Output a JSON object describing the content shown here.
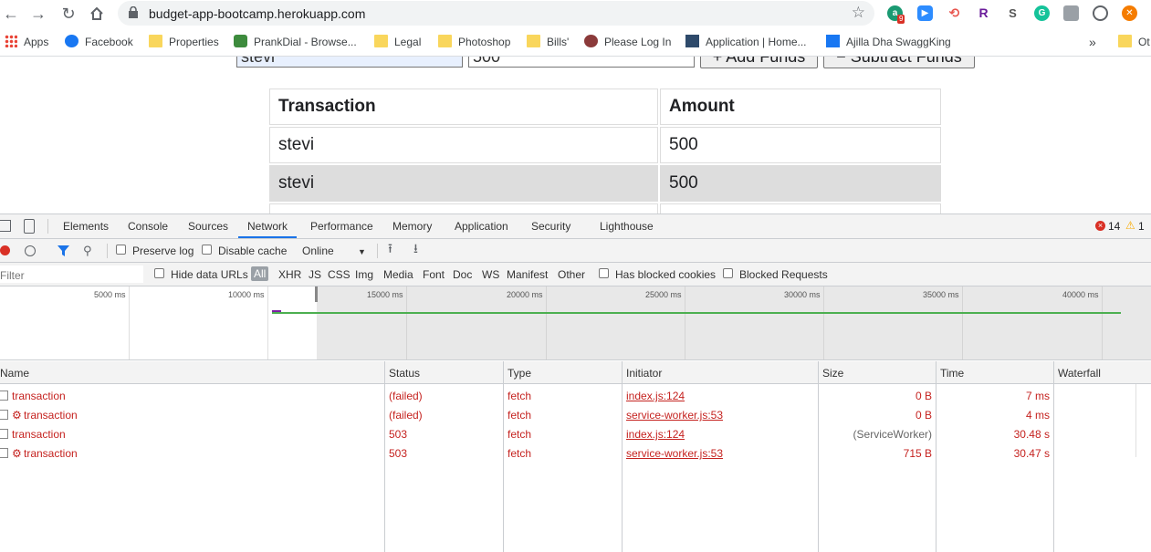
{
  "browser": {
    "url": "budget-app-bootcamp.herokuapp.com",
    "badge_count": "9"
  },
  "bookmarks": [
    {
      "label": "Apps",
      "icon": "apps-grid-icon"
    },
    {
      "label": "Facebook",
      "icon": "facebook-icon"
    },
    {
      "label": "Properties",
      "icon": "folder-icon"
    },
    {
      "label": "PrankDial - Browse...",
      "icon": "prankdial-icon"
    },
    {
      "label": "Legal",
      "icon": "folder-icon"
    },
    {
      "label": "Photoshop",
      "icon": "folder-icon"
    },
    {
      "label": "Bills'",
      "icon": "folder-icon"
    },
    {
      "label": "Please Log In",
      "icon": "globe-icon"
    },
    {
      "label": "Application | Home...",
      "icon": "app-icon"
    },
    {
      "label": "Ajilla Dha SwaggKing",
      "icon": "facebook-icon"
    }
  ],
  "bookmarks_overflow": "»",
  "bookmarks_other": "Ot",
  "page": {
    "name_value": "stevi",
    "amount_value": "500",
    "add_button": "+ Add Funds",
    "subtract_button": "− Subtract Funds",
    "table": {
      "headers": [
        "Transaction",
        "Amount"
      ],
      "rows": [
        [
          "stevi",
          "500"
        ],
        [
          "stevi",
          "500"
        ]
      ]
    }
  },
  "devtools": {
    "tabs": [
      "Elements",
      "Console",
      "Sources",
      "Network",
      "Performance",
      "Memory",
      "Application",
      "Security",
      "Lighthouse"
    ],
    "active_tab": "Network",
    "errors": "14",
    "warnings": "1",
    "preserve_log": "Preserve log",
    "disable_cache": "Disable cache",
    "throttle": "Online",
    "filter_placeholder": "Filter",
    "hide_data_urls": "Hide data URLs",
    "filter_types": [
      "All",
      "XHR",
      "JS",
      "CSS",
      "Img",
      "Media",
      "Font",
      "Doc",
      "WS",
      "Manifest",
      "Other"
    ],
    "has_blocked_cookies": "Has blocked cookies",
    "blocked_requests": "Blocked Requests",
    "timeline_ticks": [
      "5000 ms",
      "10000 ms",
      "15000 ms",
      "20000 ms",
      "25000 ms",
      "30000 ms",
      "35000 ms",
      "40000 ms"
    ],
    "columns": [
      "Name",
      "Status",
      "Type",
      "Initiator",
      "Size",
      "Time",
      "Waterfall"
    ],
    "requests": [
      {
        "name": "transaction",
        "worker": false,
        "status": "(failed)",
        "type": "fetch",
        "initiator": "index.js:124",
        "size": "0 B",
        "time": "7 ms"
      },
      {
        "name": "transaction",
        "worker": true,
        "status": "(failed)",
        "type": "fetch",
        "initiator": "service-worker.js:53",
        "size": "0 B",
        "time": "4 ms"
      },
      {
        "name": "transaction",
        "worker": false,
        "status": "503",
        "type": "fetch",
        "initiator": "index.js:124",
        "size": "(ServiceWorker)",
        "time": "30.48 s"
      },
      {
        "name": "transaction",
        "worker": true,
        "status": "503",
        "type": "fetch",
        "initiator": "service-worker.js:53",
        "size": "715 B",
        "time": "30.47 s"
      }
    ]
  }
}
